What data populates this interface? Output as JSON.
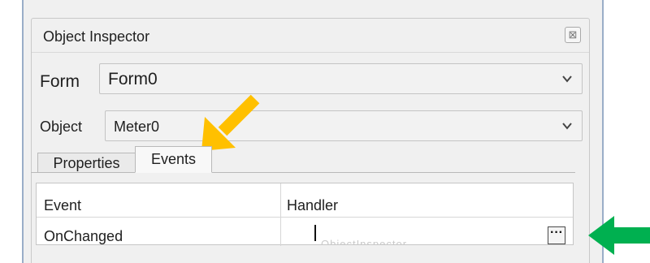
{
  "panel": {
    "title": "Object Inspector",
    "close_glyph": "⊠"
  },
  "form_row": {
    "label": "Form",
    "value": "Form0"
  },
  "object_row": {
    "label": "Object",
    "value": "Meter0"
  },
  "tabs": [
    {
      "label": "Properties",
      "active": false
    },
    {
      "label": "Events",
      "active": true
    }
  ],
  "grid": {
    "columns": [
      "Event",
      "Handler"
    ],
    "rows": [
      {
        "event": "OnChanged",
        "handler": "",
        "button": "···",
        "ghost": "ObjectInspector"
      }
    ]
  },
  "annotations": {
    "arrow_colors": {
      "yellow": "#ffc000",
      "green": "#00b050"
    }
  }
}
